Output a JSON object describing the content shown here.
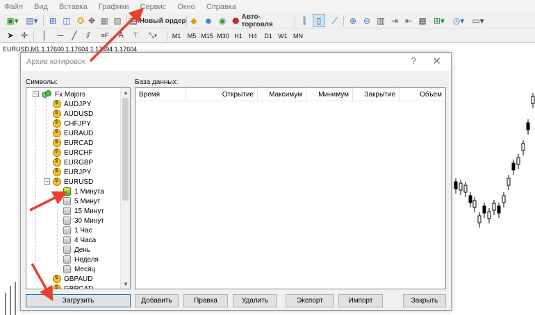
{
  "menu": {
    "items": [
      "Файл",
      "Вид",
      "Вставка",
      "Графики",
      "Сервис",
      "Окно",
      "Справка"
    ]
  },
  "toolbar": {
    "new_order": "Новый ордер",
    "auto_trading": "Авто-торговля"
  },
  "timeframes": [
    "M1",
    "M5",
    "M15",
    "M30",
    "H1",
    "H4",
    "D1",
    "W1",
    "MN"
  ],
  "chart": {
    "label": "EURUSD,M1  1.17600 1.17604 1.17594 1.17604"
  },
  "dialog": {
    "title": "Архив котировок",
    "help": "?",
    "close": "✕",
    "symbols_label": "Символы:",
    "database_label": "База данных:",
    "tree": {
      "group": "Fx Majors",
      "symbols": [
        "AUDJPY",
        "AUDUSD",
        "CHFJPY",
        "EURAUD",
        "EURCAD",
        "EURCHF",
        "EURGBP",
        "EURJPY",
        "EURUSD"
      ],
      "periods": [
        "1 Минута",
        "5 Минут",
        "15 Минут",
        "30 Минут",
        "1 Час",
        "4 Часа",
        "День",
        "Неделя",
        "Месяц"
      ],
      "after": [
        "GBPAUD",
        "GBPCAD"
      ]
    },
    "columns": [
      "Время",
      "Открытие",
      "Максимум",
      "Минимум",
      "Закрытие",
      "Объем"
    ],
    "buttons": {
      "load": "Загрузить",
      "add": "Добавить",
      "edit": "Правка",
      "delete": "Удалить",
      "export": "Экспорт",
      "import": "Импорт",
      "close": "Закрыть"
    }
  },
  "colors": {
    "arrow": "#e8402a",
    "accent": "#0078d7"
  }
}
